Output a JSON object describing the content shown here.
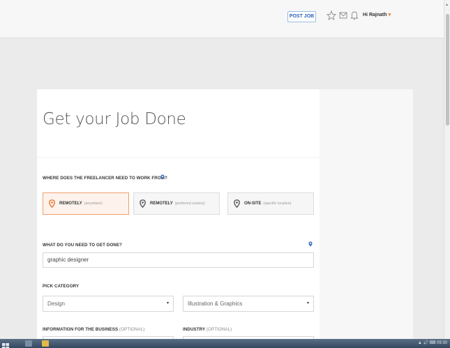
{
  "header": {
    "post_job_label": "POST JOB",
    "greeting": "Hi Rajnath",
    "greeting_caret": "▾"
  },
  "form": {
    "title": "Get your Job Done",
    "location_question": "WHERE DOES THE FREELANCER NEED TO WORK FROM?",
    "location_options": [
      {
        "label": "REMOTELY",
        "sub": "(anywhere)",
        "selected": true
      },
      {
        "label": "REMOTELY",
        "sub": "(preferred country)",
        "selected": false
      },
      {
        "label": "ON-SITE",
        "sub": "(specific location)",
        "selected": false
      }
    ],
    "task_question": "WHAT DO YOU NEED TO GET DONE?",
    "task_value": "graphic designer",
    "category_label": "PICK CATEGORY",
    "category_value": "Design",
    "subcategory_value": "Illustration & Graphics",
    "business_info_label": "INFORMATION FOR THE BUSINESS",
    "business_info_optional": "(OPTIONAL)",
    "industry_label": "INDUSTRY",
    "industry_optional": "(OPTIONAL)"
  },
  "taskbar": {
    "tray_text": "▲ 🔊 ⌨ 09:30"
  },
  "colors": {
    "accent_blue": "#2b63b8",
    "accent_orange": "#e8752d",
    "selected_border": "#f0a070"
  }
}
